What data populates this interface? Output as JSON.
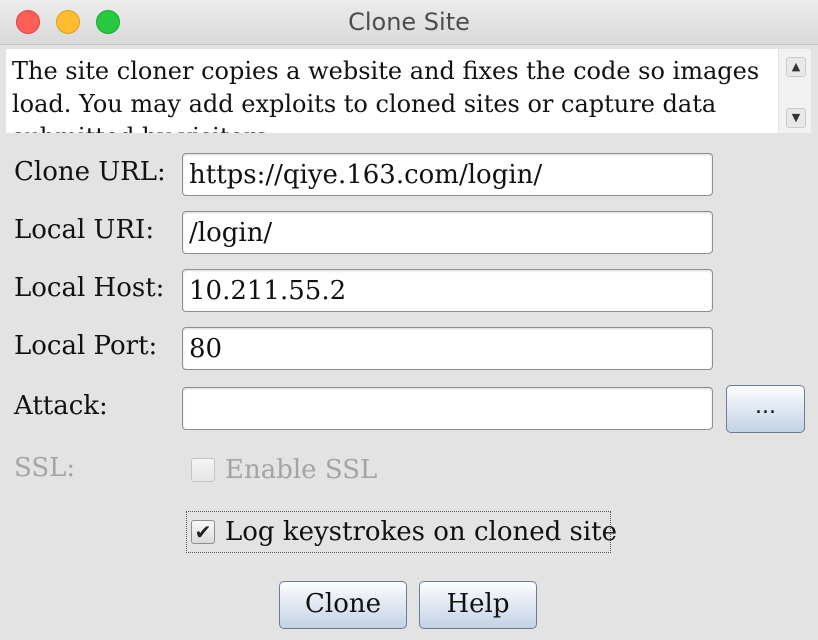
{
  "window": {
    "title": "Clone Site"
  },
  "description": {
    "text": "The site cloner copies a website and fixes the code so images load. You may add exploits to cloned sites or capture data submitted by visitors."
  },
  "form": {
    "clone_url": {
      "label": "Clone URL:",
      "value": "https://qiye.163.com/login/"
    },
    "local_uri": {
      "label": "Local URI:",
      "value": "/login/"
    },
    "local_host": {
      "label": "Local Host:",
      "value": "10.211.55.2"
    },
    "local_port": {
      "label": "Local Port:",
      "value": "80"
    },
    "attack": {
      "label": "Attack:",
      "value": "",
      "browse_label": "..."
    },
    "ssl": {
      "label": "SSL:",
      "checkbox_label": "Enable SSL",
      "checked": false,
      "enabled": false
    },
    "log_keystrokes": {
      "checkbox_label": "Log keystrokes on cloned site",
      "checked": true,
      "checkmark": "✔"
    }
  },
  "buttons": {
    "clone": "Clone",
    "help": "Help"
  },
  "scroll": {
    "up_glyph": "▲",
    "down_glyph": "▼"
  },
  "colors": {
    "accent_button": "#c3d2e6",
    "disabled_text": "#a4a4a4"
  },
  "icons": {
    "close": "close-traffic-light-icon",
    "minimize": "minimize-traffic-light-icon",
    "maximize": "maximize-traffic-light-icon",
    "scroll_up": "scroll-up-arrow-icon",
    "scroll_down": "scroll-down-arrow-icon",
    "checkbox": "checkbox-icon"
  }
}
